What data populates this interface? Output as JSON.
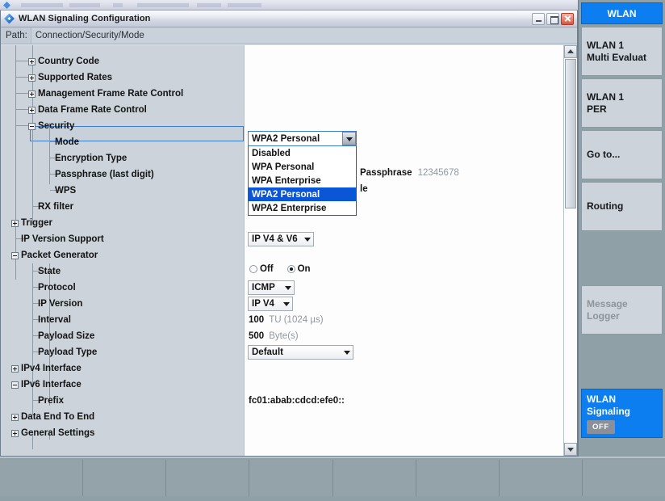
{
  "window": {
    "title": "WLAN Signaling Configuration",
    "icon": "diamond-icon",
    "minimize_label": "Minimize",
    "maximize_label": "Maximize",
    "close_label": "Close"
  },
  "path_bar": {
    "label": "Path:",
    "value": "Connection/Security/Mode"
  },
  "tree": [
    {
      "label": "Country Code",
      "state": "collapsed",
      "depth": 1
    },
    {
      "label": "Supported Rates",
      "state": "collapsed",
      "depth": 1
    },
    {
      "label": "Management Frame Rate Control",
      "state": "collapsed",
      "depth": 1
    },
    {
      "label": "Data Frame Rate Control",
      "state": "collapsed",
      "depth": 1
    },
    {
      "label": "Security",
      "state": "expanded",
      "depth": 1
    },
    {
      "label": "Mode",
      "state": "leaf",
      "depth": 2,
      "selected": true
    },
    {
      "label": "Encryption Type",
      "state": "leaf",
      "depth": 2
    },
    {
      "label": "Passphrase (last digit)",
      "state": "leaf",
      "depth": 2
    },
    {
      "label": "WPS",
      "state": "leaf",
      "depth": 2
    },
    {
      "label": "RX filter",
      "state": "leaf",
      "depth": 1
    },
    {
      "label": "Trigger",
      "state": "collapsed",
      "depth": 0
    },
    {
      "label": "IP Version Support",
      "state": "leaf",
      "depth": 0
    },
    {
      "label": "Packet Generator",
      "state": "expanded",
      "depth": 0
    },
    {
      "label": "State",
      "state": "leaf",
      "depth": 1
    },
    {
      "label": "Protocol",
      "state": "leaf",
      "depth": 1
    },
    {
      "label": "IP Version",
      "state": "leaf",
      "depth": 1
    },
    {
      "label": "Interval",
      "state": "leaf",
      "depth": 1
    },
    {
      "label": "Payload Size",
      "state": "leaf",
      "depth": 1
    },
    {
      "label": "Payload Type",
      "state": "leaf",
      "depth": 1
    },
    {
      "label": "IPv4 Interface",
      "state": "collapsed",
      "depth": 0
    },
    {
      "label": "IPv6 Interface",
      "state": "expanded",
      "depth": 0
    },
    {
      "label": "Prefix",
      "state": "leaf",
      "depth": 1
    },
    {
      "label": "Data End To End",
      "state": "collapsed",
      "depth": 0
    },
    {
      "label": "General Settings",
      "state": "collapsed",
      "depth": 0
    }
  ],
  "values": {
    "mode": {
      "selected": "WPA2 Personal",
      "options": [
        "Disabled",
        "WPA Personal",
        "WPA Enterprise",
        "WPA2 Personal",
        "WPA2 Enterprise"
      ],
      "highlighted": "WPA2 Personal"
    },
    "passphrase_label": "Passphrase",
    "passphrase_value": "12345678",
    "wps_partial": "le",
    "ip_version_support": "IP V4 & V6",
    "state_off": "Off",
    "state_on": "On",
    "protocol": "ICMP",
    "ip_version": "IP V4",
    "interval_value": "100",
    "interval_unit": "TU (1024 µs)",
    "payload_size_value": "500",
    "payload_size_unit": "Byte(s)",
    "payload_type": "Default",
    "prefix": "fc01:abab:cdcd:efe0::"
  },
  "sidebar": {
    "header": "WLAN",
    "keys": [
      {
        "lines": [
          "WLAN 1",
          "Multi Evaluat"
        ],
        "state": "normal"
      },
      {
        "lines": [
          "WLAN 1",
          "PER"
        ],
        "state": "normal"
      },
      {
        "lines": [
          "Go to..."
        ],
        "state": "normal"
      },
      {
        "lines": [
          "Routing"
        ],
        "state": "normal"
      },
      {
        "lines": [
          "Message",
          "Logger"
        ],
        "state": "disabled"
      },
      {
        "lines": [
          "WLAN",
          "Signaling"
        ],
        "state": "active",
        "badge": "OFF"
      }
    ]
  },
  "colors": {
    "accent_blue": "#0d7ef0",
    "selection_blue": "#0a56d6",
    "focus_blue": "#3c7fd0",
    "panel_grey": "#ccd3db",
    "desktop_grey": "#8fa0a6"
  }
}
